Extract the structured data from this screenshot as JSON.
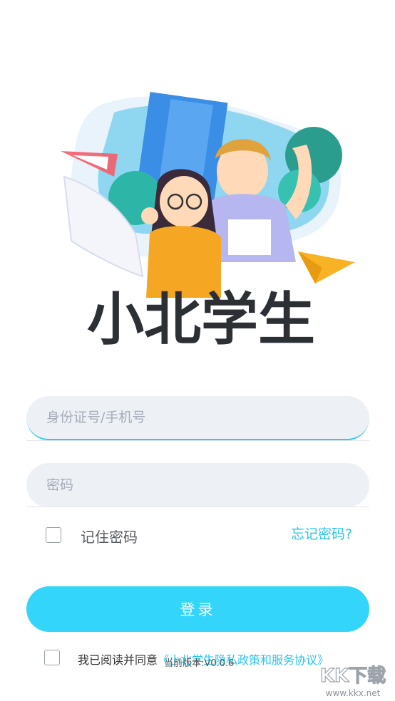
{
  "app": {
    "logo_text": "小北学生"
  },
  "login_form": {
    "id_placeholder": "身份证号/手机号",
    "password_placeholder": "密码",
    "remember_label": "记住密码",
    "forgot_label": "忘记密码?",
    "login_label": "登录"
  },
  "agreement": {
    "prefix": "我已阅读并同意",
    "policy_link": "《小北学生隐私政策和服务协议》"
  },
  "version_text": "当前版本:V0.0.6",
  "watermark": {
    "brand": "KK下载",
    "url": "www.kkx.net"
  },
  "colors": {
    "accent": "#33d6fa",
    "link": "#2cc3ea",
    "field_bg": "#edf0f5"
  }
}
